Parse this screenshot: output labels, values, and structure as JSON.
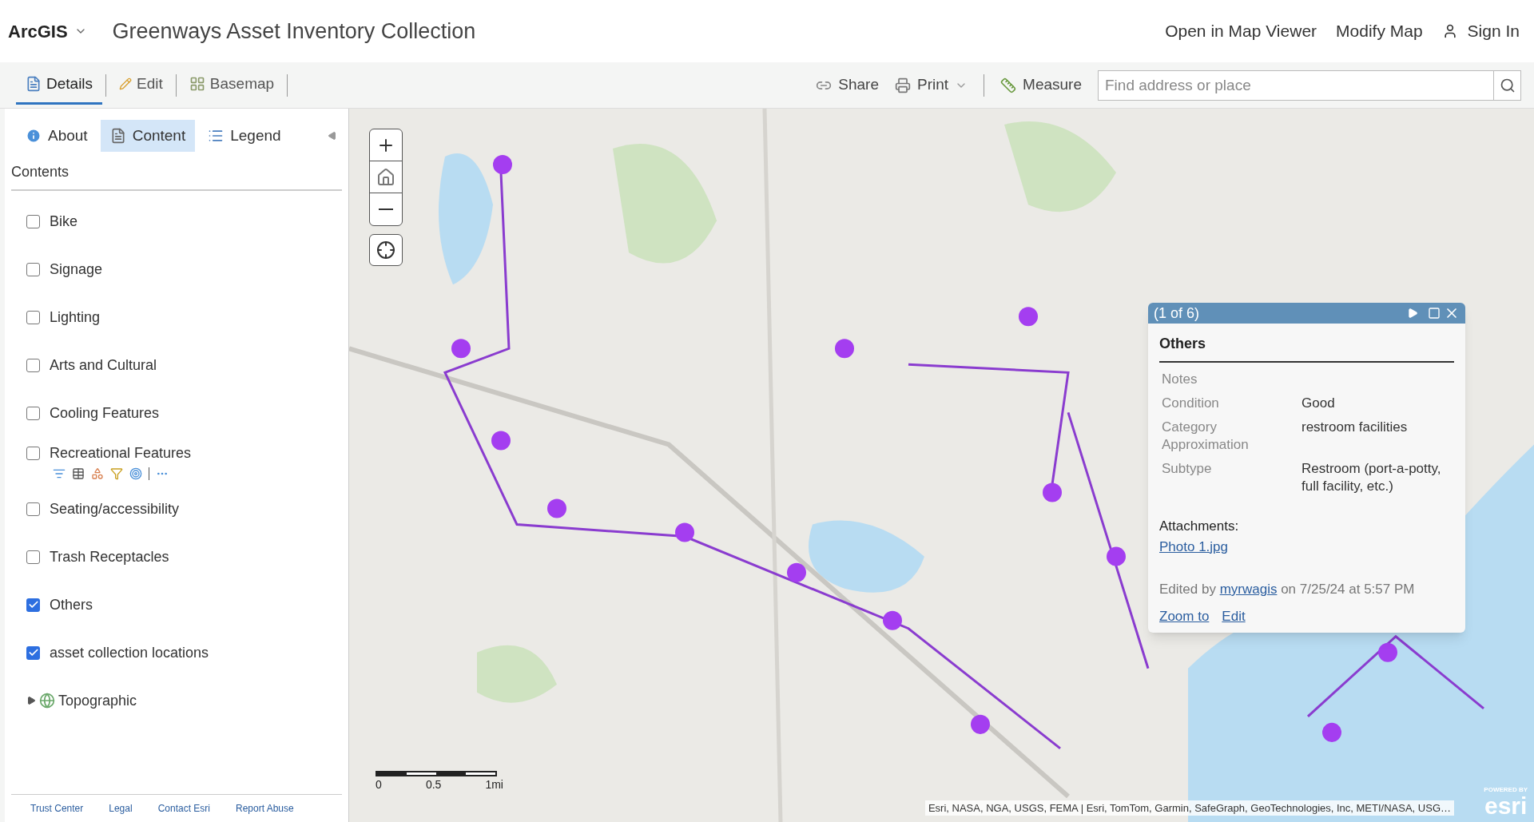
{
  "header": {
    "brand": "ArcGIS",
    "title": "Greenways Asset Inventory Collection",
    "links": [
      "Open in Map Viewer",
      "Modify Map"
    ],
    "sign_in": "Sign In"
  },
  "toolbar": {
    "tabs": [
      {
        "label": "Details",
        "selected": true
      },
      {
        "label": "Edit",
        "selected": false
      },
      {
        "label": "Basemap",
        "selected": false
      }
    ],
    "share": "Share",
    "print": "Print",
    "measure": "Measure",
    "search": {
      "placeholder": "Find address or place"
    }
  },
  "sidebar": {
    "tabs": [
      {
        "label": "About",
        "selected": false
      },
      {
        "label": "Content",
        "selected": true
      },
      {
        "label": "Legend",
        "selected": false
      }
    ],
    "heading": "Contents",
    "layers": [
      {
        "kind": "layer",
        "label": "Bike",
        "checked": false,
        "tools_shown": false
      },
      {
        "kind": "layer",
        "label": "Signage",
        "checked": false,
        "tools_shown": false
      },
      {
        "kind": "layer",
        "label": "Lighting",
        "checked": false,
        "tools_shown": false
      },
      {
        "kind": "layer",
        "label": "Arts and Cultural",
        "checked": false,
        "tools_shown": false
      },
      {
        "kind": "layer",
        "label": "Cooling Features",
        "checked": false,
        "tools_shown": false
      },
      {
        "kind": "layer",
        "label": "Recreational Features",
        "checked": false,
        "tools_shown": true
      },
      {
        "kind": "layer",
        "label": "Seating/accessibility",
        "checked": false,
        "tools_shown": false
      },
      {
        "kind": "layer",
        "label": "Trash Receptacles",
        "checked": false,
        "tools_shown": false
      },
      {
        "kind": "layer",
        "label": "Others",
        "checked": true,
        "tools_shown": false
      },
      {
        "kind": "layer",
        "label": "asset collection locations",
        "checked": true,
        "tools_shown": false
      },
      {
        "kind": "basemap",
        "label": "Topographic",
        "expanded": false
      }
    ],
    "footer": [
      "Trust Center",
      "Legal",
      "Contact Esri",
      "Report Abuse"
    ]
  },
  "map": {
    "kind": "picture",
    "scale_labels": [
      "0",
      "0.5",
      "1mi"
    ],
    "attribution": "Esri, NASA, NGA, USGS, FEMA | Esri, TomTom, Garmin, SafeGraph, GeoTechnologies, Inc, METI/NASA, USG…",
    "logo": {
      "caption": "POWERED BY",
      "name": "esri"
    },
    "popup": {
      "counter": "(1 of 6)",
      "title": "Others",
      "fields": [
        {
          "label": "Notes"
        },
        {
          "label": "Condition",
          "value": "Good"
        },
        {
          "label": "Category Approximation",
          "value": "restroom facilities"
        },
        {
          "label": "Subtype",
          "value": "Restroom (port-a-potty, full facility, etc.)"
        }
      ],
      "attachments_label": "Attachments:",
      "attachment": "Photo 1.jpg",
      "edited_prefix": "Edited by",
      "editor": "myrwagis",
      "edited_suffix": "on 7/25/24 at 5:57 PM",
      "actions": [
        "Zoom to",
        "Edit"
      ]
    }
  }
}
